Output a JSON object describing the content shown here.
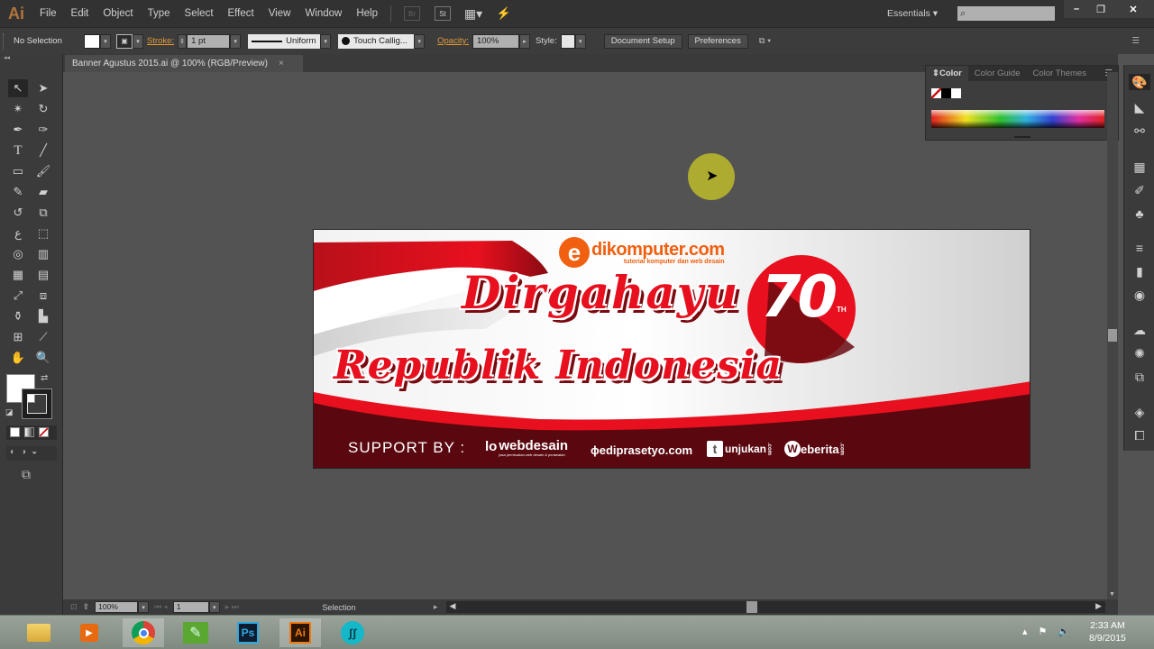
{
  "app": {
    "logo": "Ai",
    "name": "Adobe Illustrator"
  },
  "menubar": {
    "items": [
      "File",
      "Edit",
      "Object",
      "Type",
      "Select",
      "Effect",
      "View",
      "Window",
      "Help"
    ],
    "bridge_label": "Br",
    "stock_label": "St",
    "workspace": "Essentials",
    "search_placeholder": ""
  },
  "window_controls": {
    "minimize": "–",
    "restore": "❐",
    "close": "✕"
  },
  "controlbar": {
    "selection_status": "No Selection",
    "stroke_label": "Stroke:",
    "stroke_value": "1 pt",
    "stroke_profile": "Uniform",
    "brush": "Touch Callig...",
    "opacity_label": "Opacity:",
    "opacity_value": "100%",
    "style_label": "Style:",
    "document_setup": "Document Setup",
    "preferences": "Preferences"
  },
  "document_tab": {
    "title": "Banner Agustus 2015.ai @ 100% (RGB/Preview)",
    "close": "×"
  },
  "color_panel": {
    "tabs": [
      "Color",
      "Color Guide",
      "Color Themes"
    ],
    "active_tab": "Color"
  },
  "artboard": {
    "logo_letter": "e",
    "logo_name": "dikomputer.com",
    "logo_tagline": "tutorial komputer dan web desain",
    "headline1": "Dirgahayu",
    "headline2": "Republik Indonesia",
    "anniversary_number": "70",
    "anniversary_suffix": "TH",
    "support_label": "SUPPORT BY :",
    "sponsors": [
      {
        "name": "webdesain",
        "mark": "lo",
        "tagline": "jasa pembuatan web desain & perawatan"
      },
      {
        "name": "ediprasetyo.com",
        "mark": "ϕ"
      },
      {
        "name": "unjukan",
        "mark": "t",
        "suffix": ".com"
      },
      {
        "name": "eberita",
        "mark": "W",
        "suffix": ".com"
      }
    ],
    "colors": {
      "red": "#e8101e",
      "dark_red": "#6a0a10",
      "maroon": "#5a0810"
    }
  },
  "statusbar": {
    "zoom": "100%",
    "artboard_number": "1",
    "tool": "Selection"
  },
  "taskbar": {
    "apps": [
      "File Explorer",
      "Media Player",
      "Google Chrome",
      "CorelDRAW",
      "Photoshop",
      "Illustrator",
      "Snagit"
    ],
    "active_app": "Illustrator",
    "time": "2:33 AM",
    "date": "8/9/2015"
  }
}
